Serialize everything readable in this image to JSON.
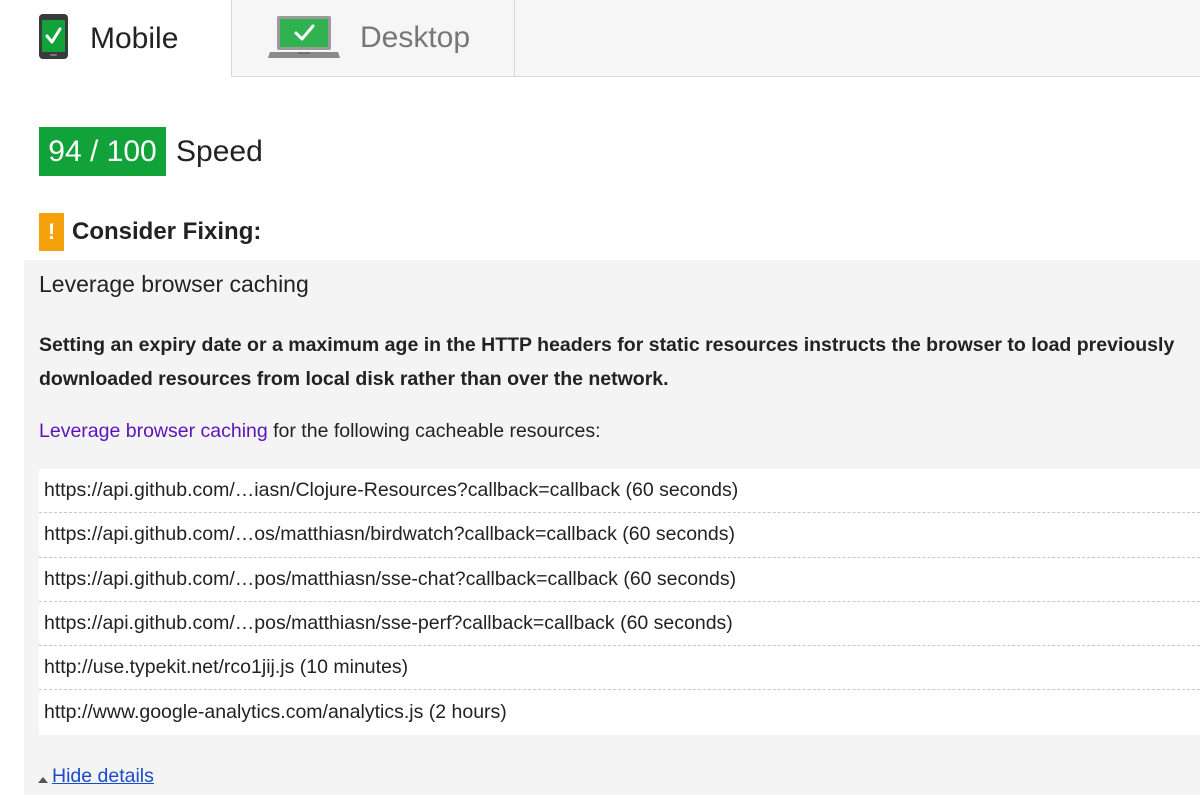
{
  "tabs": {
    "mobile_label": "Mobile",
    "desktop_label": "Desktop",
    "mobile_icon": "phone-check-icon",
    "desktop_icon": "laptop-check-icon"
  },
  "score": {
    "value": "94 / 100",
    "label": "Speed",
    "color": "#11a33a"
  },
  "consider": {
    "icon": "warning-icon",
    "icon_text": "!",
    "label": "Consider Fixing:",
    "color": "#f5a10c"
  },
  "rule": {
    "title": "Leverage browser caching",
    "description": "Setting an expiry date or a maximum age in the HTTP headers for static resources instructs the browser to load previously downloaded resources from local disk rather than over the network.",
    "intro_link": "Leverage browser caching",
    "intro_text": " for the following cacheable resources:",
    "resources": [
      "https://api.github.com/…iasn/Clojure-Resources?callback=callback (60 seconds)",
      "https://api.github.com/…os/matthiasn/birdwatch?callback=callback (60 seconds)",
      "https://api.github.com/…pos/matthiasn/sse-chat?callback=callback (60 seconds)",
      "https://api.github.com/…pos/matthiasn/sse-perf?callback=callback (60 seconds)",
      "http://use.typekit.net/rco1jij.js (10 minutes)",
      "http://www.google-analytics.com/analytics.js (2 hours)"
    ],
    "hide_details": "Hide details"
  }
}
